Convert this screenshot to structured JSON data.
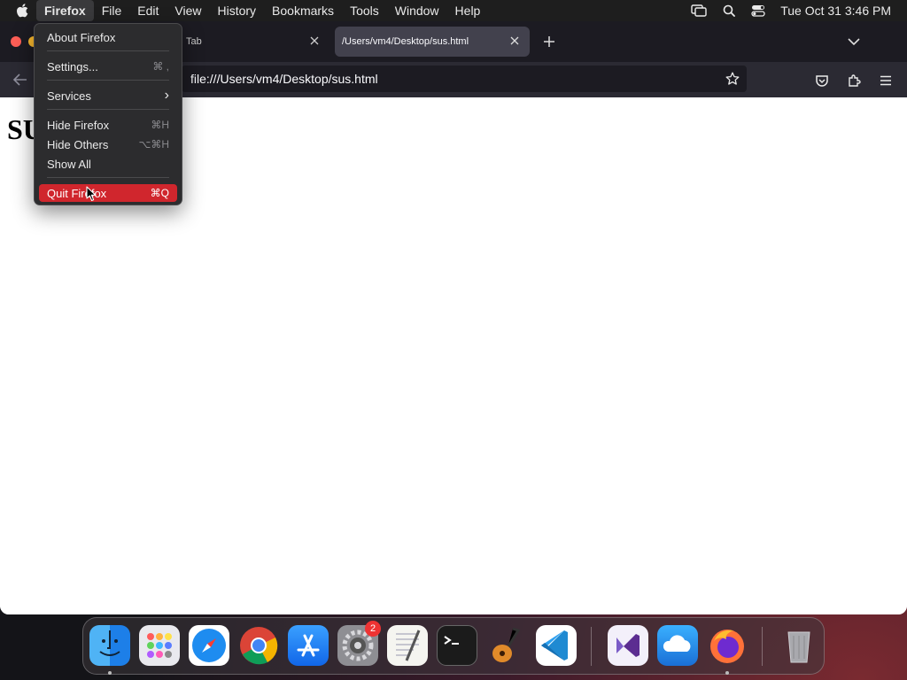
{
  "menubar": {
    "items": [
      "Firefox",
      "File",
      "Edit",
      "View",
      "History",
      "Bookmarks",
      "Tools",
      "Window",
      "Help"
    ],
    "clock": "Tue Oct 31  3:46 PM"
  },
  "tabs": [
    {
      "label": "Tab"
    },
    {
      "label": "/Users/vm4/Desktop/sus.html"
    }
  ],
  "urlbar": {
    "value": "file:///Users/vm4/Desktop/sus.html"
  },
  "page": {
    "heading": "SU"
  },
  "app_menu": {
    "items": [
      {
        "label": "About Firefox",
        "shortcut": ""
      },
      {
        "label": "Settings...",
        "shortcut": "⌘ ,"
      },
      {
        "label": "Services",
        "shortcut": "›"
      },
      {
        "label": "Hide Firefox",
        "shortcut": "⌘H"
      },
      {
        "label": "Hide Others",
        "shortcut": "⌥⌘H"
      },
      {
        "label": "Show All",
        "shortcut": ""
      },
      {
        "label": "Quit Firefox",
        "shortcut": "⌘Q"
      }
    ],
    "highlighted": "Quit Firefox"
  },
  "dock": {
    "apps": [
      "Finder",
      "Launchpad",
      "Safari",
      "Chrome",
      "App Store",
      "System Settings",
      "TextEdit",
      "Terminal",
      "GarageBand",
      "Visual Studio Code",
      "Visual Studio",
      "iCloud",
      "Firefox",
      "Trash"
    ],
    "badge": "2"
  },
  "colors": {
    "menu_highlight": "#d0262d",
    "close": "#ff5f57",
    "minimize": "#febc2e"
  }
}
